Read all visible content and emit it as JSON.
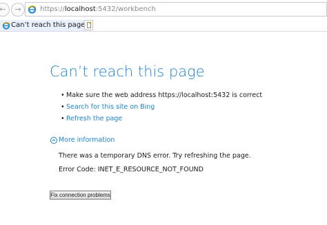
{
  "browser": {
    "address": {
      "scheme": "https://",
      "host": "localhost",
      "path": ":5432/workbench"
    },
    "tab": {
      "title": "Can’t reach this page",
      "close_label": "x"
    },
    "icons": {
      "back": "back-arrow-icon",
      "forward": "forward-arrow-icon",
      "site": "ie-logo-icon",
      "new_tab": "new-tab-icon"
    }
  },
  "error": {
    "title": "Can’t reach this page",
    "suggestions": [
      {
        "text": "Make sure the web address https://localhost:5432 is correct",
        "is_link": false
      },
      {
        "text": "Search for this site on Bing",
        "is_link": true
      },
      {
        "text": "Refresh the page",
        "is_link": true
      }
    ],
    "more_info_label": "More information",
    "dns_message": "There was a temporary DNS error. Try refreshing the page.",
    "error_code": "Error Code: INET_E_RESOURCE_NOT_FOUND",
    "fix_button_label": "Fix connection problems"
  },
  "colors": {
    "accent": "#1e84d0",
    "text": "#1a1a1a",
    "tab_active": "#e7f0fb"
  }
}
